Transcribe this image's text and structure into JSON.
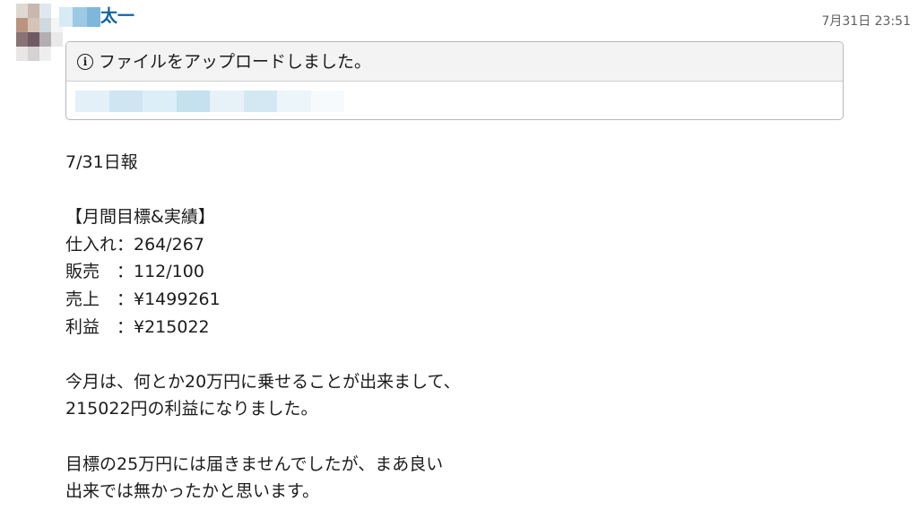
{
  "message": {
    "sender_name": "太一",
    "timestamp": "7月31日 23:51",
    "attachment": {
      "icon": "info-icon",
      "title": "ファイルをアップロードしました。"
    },
    "lines": [
      "7/31日報",
      "",
      "【月間目標&実績】",
      "仕入れ：264/267",
      "販売　：112/100",
      "売上　：¥1499261",
      "利益　：¥215022",
      "",
      "今月は、何とか20万円に乗せることが出来まして、",
      "215022円の利益になりました。",
      "",
      "目標の25万円には届きませんでしたが、まあ良い",
      "出来では無かったかと思います。"
    ]
  },
  "colors": {
    "sender_name": "#1264a3",
    "timestamp": "#616061",
    "card_header_bg": "#f3f3f3",
    "card_border": "#b8b8b8"
  }
}
